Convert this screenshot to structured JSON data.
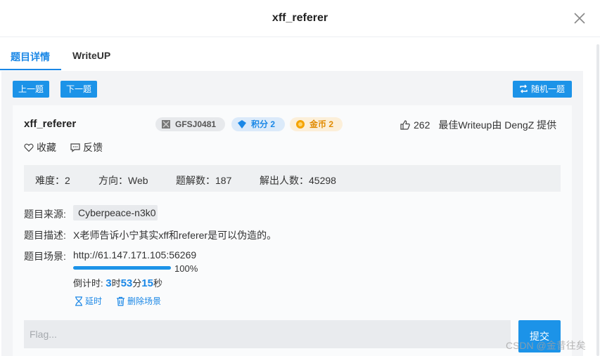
{
  "modal": {
    "title": "xff_referer",
    "close_icon": "close-icon"
  },
  "tabs": [
    {
      "label": "题目详情",
      "active": true
    },
    {
      "label": "WriteUP",
      "active": false
    }
  ],
  "nav": {
    "prev_label": "上一题",
    "next_label": "下一题",
    "random_label": "随机一题",
    "random_icon": "shuffle-icon"
  },
  "challenge": {
    "title": "xff_referer",
    "id_tag": "GFSJ0481",
    "score_tag": "积分 2",
    "coin_tag": "金币 2",
    "likes": "262",
    "best_writeup": "最佳Writeup由 DengZ 提供",
    "favorite_label": "收藏",
    "feedback_label": "反馈"
  },
  "stats": {
    "difficulty": "难度：2",
    "direction": "方向：Web",
    "solves": "题解数：187",
    "solvers": "解出人数：45298"
  },
  "details": {
    "source_label": "题目来源:",
    "source_value": "Cyberpeace-n3k0",
    "desc_label": "题目描述:",
    "desc_value": "X老师告诉小宁其实xff和referer是可以伪造的。",
    "scene_label": "题目场景:",
    "scene_url": "http://61.147.171.105:56269",
    "progress_text": "100%",
    "progress_value": 1.0,
    "countdown_prefix": "倒计时: ",
    "countdown_h": "3",
    "countdown_h_unit": "时",
    "countdown_m": "53",
    "countdown_m_unit": "分",
    "countdown_s": "15",
    "countdown_s_unit": "秒",
    "extend_label": "延时",
    "delete_label": "删除场景"
  },
  "flag": {
    "placeholder": "Flag...",
    "submit_label": "提交"
  },
  "watermark": "CSDN @金昔往矣",
  "colors": {
    "accent": "#1c93e8",
    "coin": "#e08a00"
  }
}
